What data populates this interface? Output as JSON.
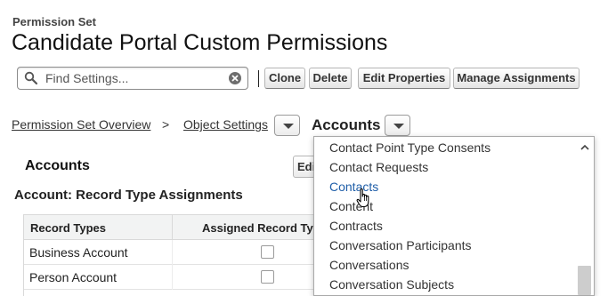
{
  "header": {
    "label": "Permission Set",
    "title": "Candidate Portal Custom Permissions"
  },
  "search": {
    "placeholder": "Find Settings...",
    "icon": "search-icon",
    "clear_icon": "clear-icon"
  },
  "toolbar": {
    "clone": "Clone",
    "delete": "Delete",
    "edit_properties": "Edit Properties",
    "manage_assignments": "Manage Assignments"
  },
  "breadcrumb": {
    "overview": "Permission Set Overview",
    "separator": ">",
    "object_settings": "Object Settings",
    "current": "Accounts"
  },
  "main": {
    "section_title": "Accounts",
    "edit_button": "Edit",
    "subheading": "Account: Record Type Assignments",
    "table": {
      "columns": [
        "Record Types",
        "Assigned Record Types"
      ],
      "rows": [
        {
          "name": "Business Account",
          "assigned": false
        },
        {
          "name": "Person Account",
          "assigned": false
        }
      ]
    }
  },
  "dropdown": {
    "items": [
      "Contact Point Type Consents",
      "Contact Requests",
      "Contacts",
      "Content",
      "Contracts",
      "Conversation Participants",
      "Conversations",
      "Conversation Subjects"
    ],
    "hovered_item": "Contacts"
  },
  "colors": {
    "link_hover": "#1f5ea8",
    "table_header_bg": "#f2f3f3"
  }
}
